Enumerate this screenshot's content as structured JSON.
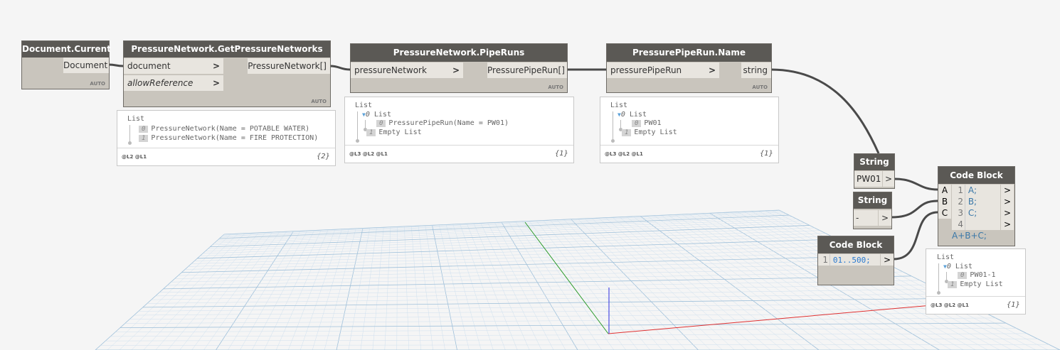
{
  "nodes": {
    "document_current": {
      "title": "Document.Current",
      "output": "Document",
      "lacing": "AUTO"
    },
    "get_networks": {
      "title": "PressureNetwork.GetPressureNetworks",
      "inputs": [
        "document",
        "allowReference"
      ],
      "output": "PressureNetwork[]",
      "lacing": "AUTO"
    },
    "pipe_runs": {
      "title": "PressureNetwork.PipeRuns",
      "input": "pressureNetwork",
      "output": "PressurePipeRun[]",
      "lacing": "AUTO"
    },
    "pipe_run_name": {
      "title": "PressurePipeRun.Name",
      "input": "pressurePipeRun",
      "output": "string",
      "lacing": "AUTO"
    },
    "string1": {
      "title": "String",
      "value": "PW01",
      "out": ">"
    },
    "string2": {
      "title": "String",
      "value": "-",
      "out": ">"
    },
    "code_block_small": {
      "title": "Code Block",
      "line_no": "1",
      "code": "01..500;",
      "out": ">"
    },
    "code_block_main": {
      "title": "Code Block",
      "inputs": [
        "A",
        "B",
        "C"
      ],
      "lines": [
        {
          "n": "1",
          "code": "A;"
        },
        {
          "n": "2",
          "code": "B;"
        },
        {
          "n": "3",
          "code": "C;"
        },
        {
          "n": "4",
          "code": "A+B+C;"
        }
      ],
      "out": ">"
    }
  },
  "previews": {
    "p1": {
      "root": "List",
      "items": [
        {
          "i": "0",
          "text": "PressureNetwork(Name = POTABLE WATER)"
        },
        {
          "i": "1",
          "text": "PressureNetwork(Name = FIRE PROTECTION)"
        }
      ],
      "levels": "@L2 @L1",
      "count": "{2}"
    },
    "p2": {
      "root": "List",
      "sub": "0",
      "sub_label": "List",
      "items": [
        {
          "i": "0",
          "text": "PressurePipeRun(Name = PW01)"
        },
        {
          "i": "1",
          "text": "Empty List"
        }
      ],
      "levels": "@L3 @L2 @L1",
      "count": "{1}"
    },
    "p3": {
      "root": "List",
      "sub": "0",
      "sub_label": "List",
      "items": [
        {
          "i": "0",
          "text": "PW01"
        },
        {
          "i": "1",
          "text": "Empty List"
        }
      ],
      "levels": "@L3 @L2 @L1",
      "count": "{1}"
    },
    "p4": {
      "root": "List",
      "sub": "0",
      "sub_label": "List",
      "items": [
        {
          "i": "0",
          "text": "PW01-1"
        },
        {
          "i": "1",
          "text": "Empty List"
        }
      ],
      "levels": "@L3 @L2 @L1",
      "count": "{1}"
    }
  },
  "colors": {
    "header": "#5b5955",
    "node_body": "#c9c5bd",
    "wire": "#4a4a4a",
    "grid": "#b9d3e6",
    "axis_x": "#e03030",
    "axis_y": "#2a9a2a",
    "axis_z": "#2a2ae0"
  }
}
